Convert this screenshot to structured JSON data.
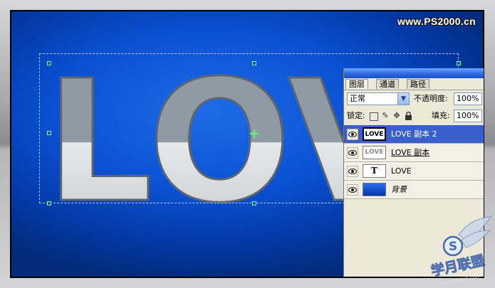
{
  "watermark": "www.PS2000.cn",
  "canvas": {
    "artwork_text": "LOVE",
    "colors": {
      "background": "#0a52d4",
      "text_top": "#9fa9b2",
      "text_bottom": "#d6d8dc"
    }
  },
  "layers_panel": {
    "tabs": [
      {
        "label": "图层",
        "active": true
      },
      {
        "label": "通道",
        "active": false
      },
      {
        "label": "路径",
        "active": false
      }
    ],
    "blend_mode": "正常",
    "opacity_label": "不透明度:",
    "opacity_value": "100%",
    "lock_label": "锁定:",
    "fill_label": "填充:",
    "fill_value": "100%",
    "layers": [
      {
        "name": "LOVE 副本 2",
        "thumb": "LOVE",
        "selected": true
      },
      {
        "name": "LOVE 副本",
        "thumb": "LOVE",
        "selected": false
      },
      {
        "name": "LOVE",
        "thumb": "T",
        "selected": false
      },
      {
        "name": "背景",
        "thumb": "",
        "selected": false
      }
    ]
  },
  "logo": {
    "text": "学月联盟",
    "subtext": "www.52pjsk.com",
    "badge": "S"
  }
}
